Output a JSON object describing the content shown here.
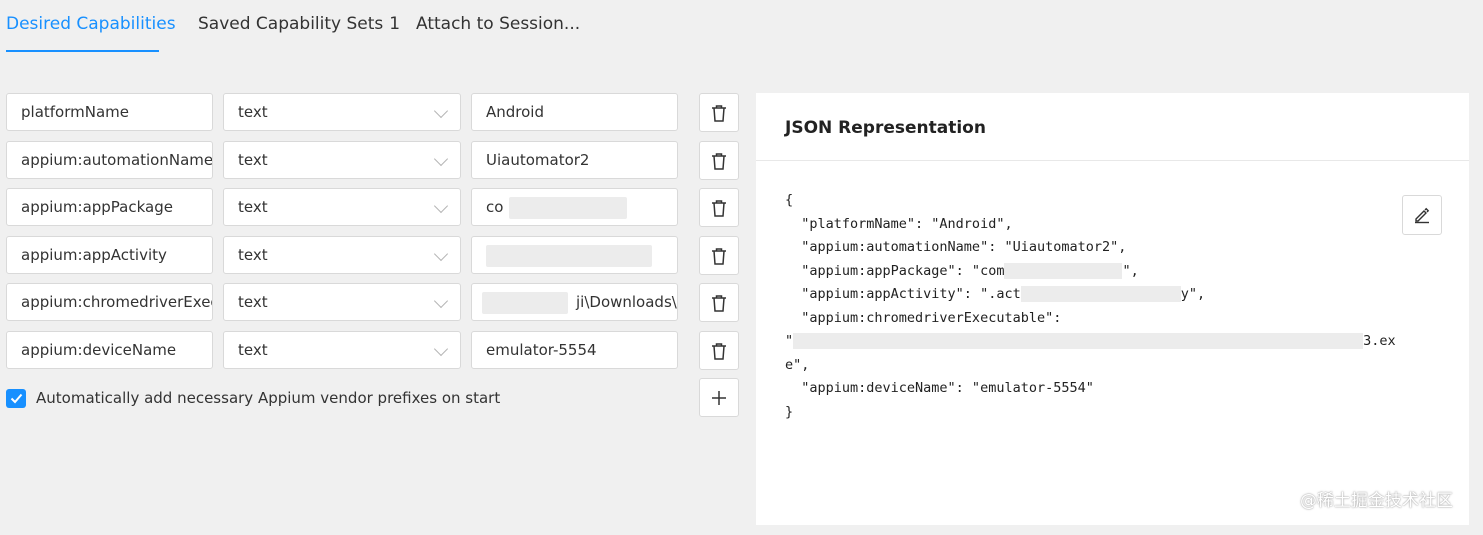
{
  "tabs": [
    {
      "label": "Desired Capabilities",
      "count": ""
    },
    {
      "label": "Saved Capability Sets",
      "count": "1"
    },
    {
      "label": "Attach to Session...",
      "count": ""
    }
  ],
  "capabilities": [
    {
      "name": "platformName",
      "type": "text",
      "value": "Android"
    },
    {
      "name": "appium:automationName",
      "type": "text",
      "value": "Uiautomator2"
    },
    {
      "name": "appium:appPackage",
      "type": "text",
      "value": "co"
    },
    {
      "name": "appium:appActivity",
      "type": "text",
      "value": ""
    },
    {
      "name": "appium:chromedriverExecu",
      "type": "text",
      "value": "ji\\Downloads\\("
    },
    {
      "name": "appium:deviceName",
      "type": "text",
      "value": "emulator-5554"
    }
  ],
  "vendor_prefix": {
    "checked": true,
    "label": "Automatically add necessary Appium vendor prefixes on start"
  },
  "json_panel": {
    "title": "JSON Representation",
    "lines": {
      "open": "{",
      "platformName": "  \"platformName\": \"Android\",",
      "automationName": "  \"appium:automationName\": \"Uiautomator2\",",
      "appPackage_start": "  \"appium:appPackage\": \"com",
      "appPackage_end": "\",",
      "appActivity_start": "  \"appium:appActivity\": \".act",
      "appActivity_end": "y\",",
      "chromedriver_key": "  \"appium:chromedriverExecutable\":",
      "chromedriver_start": "\"",
      "chromedriver_end": "3.ex",
      "chromedriver_wrap": "e\",",
      "deviceName": "  \"appium:deviceName\": \"emulator-5554\"",
      "close": "}"
    }
  },
  "icons": {
    "delete": "trash-icon",
    "add": "plus-icon",
    "edit": "pencil-icon",
    "dropdown": "chevron-down-icon",
    "check": "checkmark-icon"
  },
  "colors": {
    "accent": "#1890ff",
    "background": "#f0f0f0"
  },
  "watermark": "@稀土掘金技术社区"
}
